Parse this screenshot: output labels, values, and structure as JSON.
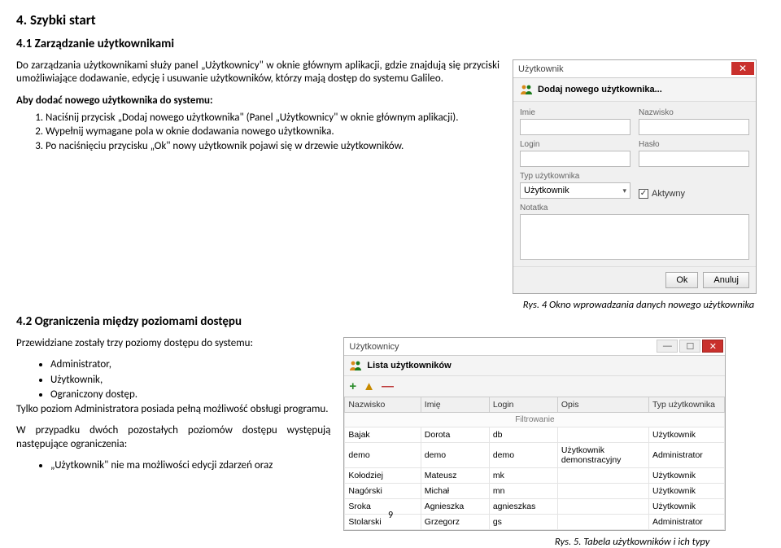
{
  "h1": "4. Szybki start",
  "h2": "4.1 Zarządzanie użytkownikami",
  "p1": "Do zarządzania użytkownikami służy panel „Użytkownicy\" w oknie głównym aplikacji, gdzie znajdują się przyciski umożliwiające dodawanie, edycję i usuwanie użytkowników, którzy mają dostęp do systemu Galileo.",
  "p2": "Aby dodać nowego użytkownika do systemu:",
  "steps": [
    "Naciśnij przycisk „Dodaj nowego użytkownika\" (Panel „Użytkownicy\" w oknie głównym aplikacji).",
    "Wypełnij wymagane pola w oknie dodawania nowego użytkownika.",
    "Po naciśnięciu przycisku „Ok\" nowy użytkownik pojawi się w drzewie użytkowników."
  ],
  "caption1": "Rys. 4 Okno wprowadzania danych nowego użytkownika",
  "h3": "4.2 Ograniczenia między poziomami dostępu",
  "p3": "Przewidziane zostały trzy poziomy dostępu do systemu:",
  "levels": [
    "Administrator,",
    "Użytkownik,",
    "Ograniczony dostęp."
  ],
  "p4": "Tylko poziom Administratora posiada pełną możliwość obsługi programu.",
  "p5": "W przypadku dwóch pozostałych poziomów dostępu występują następujące ograniczenia:",
  "bullet2": "„Użytkownik\" nie ma możliwości edycji zdarzeń oraz",
  "caption2": "Rys. 5. Tabela użytkowników i ich typy",
  "page_num": "9",
  "dlg1": {
    "title": "Użytkownik",
    "header": "Dodaj nowego użytkownika...",
    "labels": {
      "imie": "Imie",
      "nazwisko": "Nazwisko",
      "login": "Login",
      "haslo": "Hasło",
      "typ": "Typ użytkownika",
      "notatka": "Notatka"
    },
    "typ_value": "Użytkownik",
    "aktywny": "Aktywny",
    "ok": "Ok",
    "anuluj": "Anuluj"
  },
  "dlg2": {
    "title": "Użytkownicy",
    "header": "Lista użytkowników",
    "cols": [
      "Nazwisko",
      "Imię",
      "Login",
      "Opis",
      "Typ użytkownika"
    ],
    "filter": "Filtrowanie",
    "rows": [
      [
        "Bajak",
        "Dorota",
        "db",
        "",
        "Użytkownik"
      ],
      [
        "demo",
        "demo",
        "demo",
        "Użytkownik demonstracyjny",
        "Administrator"
      ],
      [
        "Kołodziej",
        "Mateusz",
        "mk",
        "",
        "Użytkownik"
      ],
      [
        "Nagórski",
        "Michał",
        "mn",
        "",
        "Użytkownik"
      ],
      [
        "Sroka",
        "Agnieszka",
        "agnieszkas",
        "",
        "Użytkownik"
      ],
      [
        "Stolarski",
        "Grzegorz",
        "gs",
        "",
        "Administrator"
      ]
    ]
  }
}
